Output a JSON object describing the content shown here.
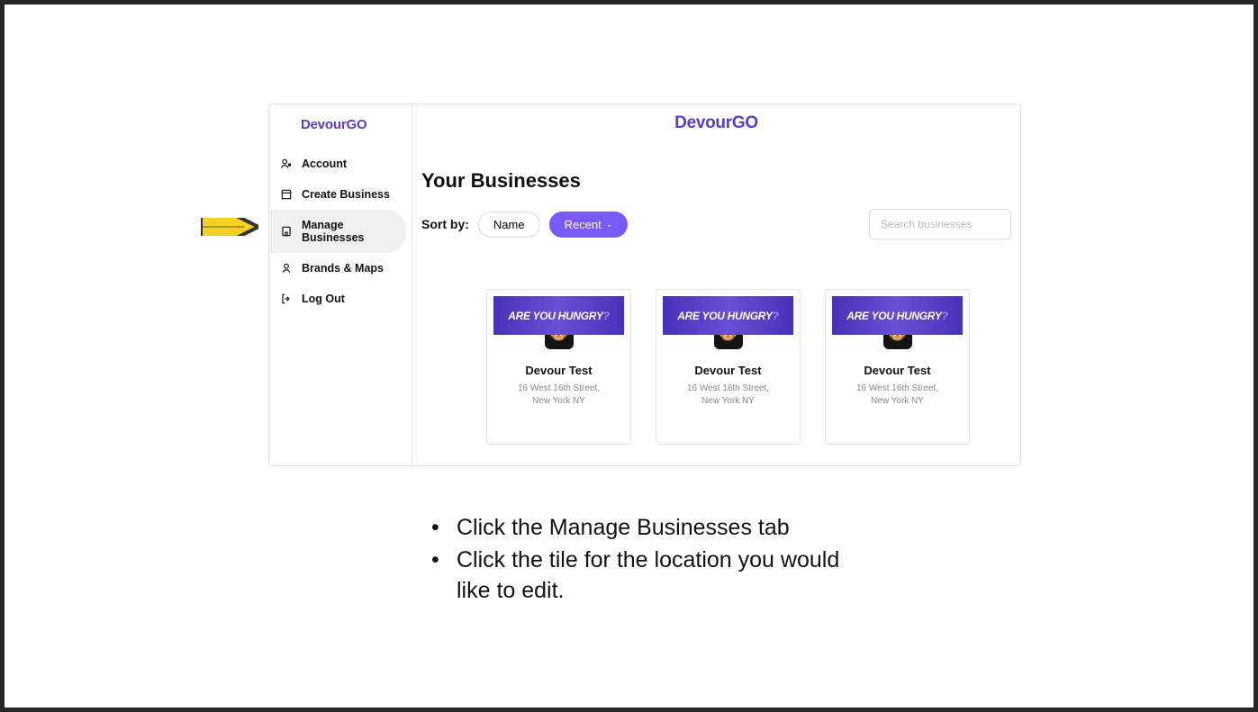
{
  "brand": {
    "name_part1": "Devour",
    "name_part2": "GO"
  },
  "sidebar": {
    "items": [
      {
        "label": "Account",
        "icon": "account-icon"
      },
      {
        "label": "Create Business",
        "icon": "store-icon"
      },
      {
        "label": "Manage Businesses",
        "icon": "business-icon"
      },
      {
        "label": "Brands & Maps",
        "icon": "brands-icon"
      },
      {
        "label": "Log Out",
        "icon": "logout-icon"
      }
    ],
    "active_index": 2
  },
  "page": {
    "title": "Your Businesses",
    "sort_label": "Sort by:",
    "sort_options": [
      {
        "label": "Name",
        "active": false
      },
      {
        "label": "Recent",
        "active": true
      }
    ],
    "search_placeholder": "Search businesses"
  },
  "banner_text_a": "ARE YOU HUNGRY",
  "banner_text_b": "?",
  "businesses": [
    {
      "name": "Devour Test",
      "address_line1": "16 West 16th Street,",
      "address_line2": "New York NY"
    },
    {
      "name": "Devour Test",
      "address_line1": "16 West 16th Street,",
      "address_line2": "New York NY"
    },
    {
      "name": "Devour Test",
      "address_line1": "16 West 16th Street,",
      "address_line2": "New York NY"
    }
  ],
  "instructions": [
    "Click the Manage Businesses tab",
    "Click the tile for the location you would like to edit."
  ]
}
